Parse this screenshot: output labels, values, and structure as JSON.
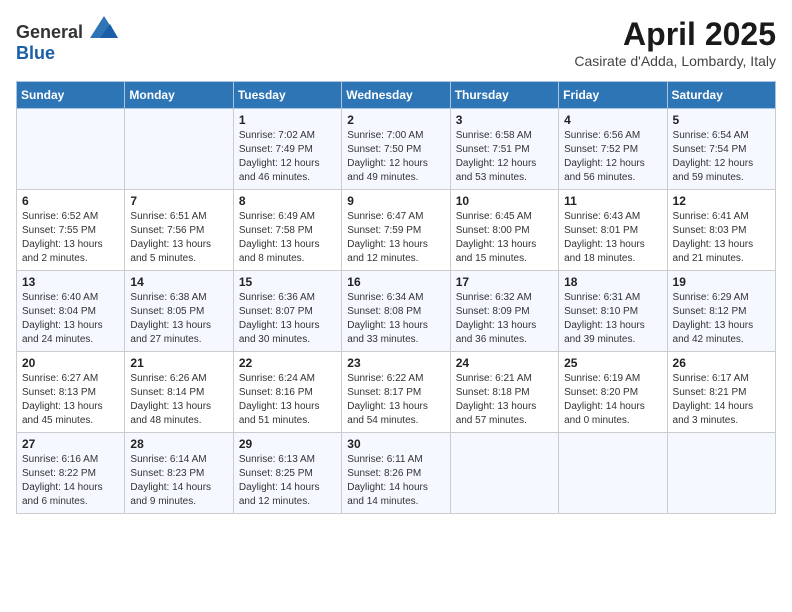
{
  "logo": {
    "general": "General",
    "blue": "Blue"
  },
  "title": "April 2025",
  "subtitle": "Casirate d'Adda, Lombardy, Italy",
  "days_of_week": [
    "Sunday",
    "Monday",
    "Tuesday",
    "Wednesday",
    "Thursday",
    "Friday",
    "Saturday"
  ],
  "weeks": [
    [
      {
        "day": null
      },
      {
        "day": null
      },
      {
        "day": "1",
        "sunrise": "Sunrise: 7:02 AM",
        "sunset": "Sunset: 7:49 PM",
        "daylight": "Daylight: 12 hours and 46 minutes."
      },
      {
        "day": "2",
        "sunrise": "Sunrise: 7:00 AM",
        "sunset": "Sunset: 7:50 PM",
        "daylight": "Daylight: 12 hours and 49 minutes."
      },
      {
        "day": "3",
        "sunrise": "Sunrise: 6:58 AM",
        "sunset": "Sunset: 7:51 PM",
        "daylight": "Daylight: 12 hours and 53 minutes."
      },
      {
        "day": "4",
        "sunrise": "Sunrise: 6:56 AM",
        "sunset": "Sunset: 7:52 PM",
        "daylight": "Daylight: 12 hours and 56 minutes."
      },
      {
        "day": "5",
        "sunrise": "Sunrise: 6:54 AM",
        "sunset": "Sunset: 7:54 PM",
        "daylight": "Daylight: 12 hours and 59 minutes."
      }
    ],
    [
      {
        "day": "6",
        "sunrise": "Sunrise: 6:52 AM",
        "sunset": "Sunset: 7:55 PM",
        "daylight": "Daylight: 13 hours and 2 minutes."
      },
      {
        "day": "7",
        "sunrise": "Sunrise: 6:51 AM",
        "sunset": "Sunset: 7:56 PM",
        "daylight": "Daylight: 13 hours and 5 minutes."
      },
      {
        "day": "8",
        "sunrise": "Sunrise: 6:49 AM",
        "sunset": "Sunset: 7:58 PM",
        "daylight": "Daylight: 13 hours and 8 minutes."
      },
      {
        "day": "9",
        "sunrise": "Sunrise: 6:47 AM",
        "sunset": "Sunset: 7:59 PM",
        "daylight": "Daylight: 13 hours and 12 minutes."
      },
      {
        "day": "10",
        "sunrise": "Sunrise: 6:45 AM",
        "sunset": "Sunset: 8:00 PM",
        "daylight": "Daylight: 13 hours and 15 minutes."
      },
      {
        "day": "11",
        "sunrise": "Sunrise: 6:43 AM",
        "sunset": "Sunset: 8:01 PM",
        "daylight": "Daylight: 13 hours and 18 minutes."
      },
      {
        "day": "12",
        "sunrise": "Sunrise: 6:41 AM",
        "sunset": "Sunset: 8:03 PM",
        "daylight": "Daylight: 13 hours and 21 minutes."
      }
    ],
    [
      {
        "day": "13",
        "sunrise": "Sunrise: 6:40 AM",
        "sunset": "Sunset: 8:04 PM",
        "daylight": "Daylight: 13 hours and 24 minutes."
      },
      {
        "day": "14",
        "sunrise": "Sunrise: 6:38 AM",
        "sunset": "Sunset: 8:05 PM",
        "daylight": "Daylight: 13 hours and 27 minutes."
      },
      {
        "day": "15",
        "sunrise": "Sunrise: 6:36 AM",
        "sunset": "Sunset: 8:07 PM",
        "daylight": "Daylight: 13 hours and 30 minutes."
      },
      {
        "day": "16",
        "sunrise": "Sunrise: 6:34 AM",
        "sunset": "Sunset: 8:08 PM",
        "daylight": "Daylight: 13 hours and 33 minutes."
      },
      {
        "day": "17",
        "sunrise": "Sunrise: 6:32 AM",
        "sunset": "Sunset: 8:09 PM",
        "daylight": "Daylight: 13 hours and 36 minutes."
      },
      {
        "day": "18",
        "sunrise": "Sunrise: 6:31 AM",
        "sunset": "Sunset: 8:10 PM",
        "daylight": "Daylight: 13 hours and 39 minutes."
      },
      {
        "day": "19",
        "sunrise": "Sunrise: 6:29 AM",
        "sunset": "Sunset: 8:12 PM",
        "daylight": "Daylight: 13 hours and 42 minutes."
      }
    ],
    [
      {
        "day": "20",
        "sunrise": "Sunrise: 6:27 AM",
        "sunset": "Sunset: 8:13 PM",
        "daylight": "Daylight: 13 hours and 45 minutes."
      },
      {
        "day": "21",
        "sunrise": "Sunrise: 6:26 AM",
        "sunset": "Sunset: 8:14 PM",
        "daylight": "Daylight: 13 hours and 48 minutes."
      },
      {
        "day": "22",
        "sunrise": "Sunrise: 6:24 AM",
        "sunset": "Sunset: 8:16 PM",
        "daylight": "Daylight: 13 hours and 51 minutes."
      },
      {
        "day": "23",
        "sunrise": "Sunrise: 6:22 AM",
        "sunset": "Sunset: 8:17 PM",
        "daylight": "Daylight: 13 hours and 54 minutes."
      },
      {
        "day": "24",
        "sunrise": "Sunrise: 6:21 AM",
        "sunset": "Sunset: 8:18 PM",
        "daylight": "Daylight: 13 hours and 57 minutes."
      },
      {
        "day": "25",
        "sunrise": "Sunrise: 6:19 AM",
        "sunset": "Sunset: 8:20 PM",
        "daylight": "Daylight: 14 hours and 0 minutes."
      },
      {
        "day": "26",
        "sunrise": "Sunrise: 6:17 AM",
        "sunset": "Sunset: 8:21 PM",
        "daylight": "Daylight: 14 hours and 3 minutes."
      }
    ],
    [
      {
        "day": "27",
        "sunrise": "Sunrise: 6:16 AM",
        "sunset": "Sunset: 8:22 PM",
        "daylight": "Daylight: 14 hours and 6 minutes."
      },
      {
        "day": "28",
        "sunrise": "Sunrise: 6:14 AM",
        "sunset": "Sunset: 8:23 PM",
        "daylight": "Daylight: 14 hours and 9 minutes."
      },
      {
        "day": "29",
        "sunrise": "Sunrise: 6:13 AM",
        "sunset": "Sunset: 8:25 PM",
        "daylight": "Daylight: 14 hours and 12 minutes."
      },
      {
        "day": "30",
        "sunrise": "Sunrise: 6:11 AM",
        "sunset": "Sunset: 8:26 PM",
        "daylight": "Daylight: 14 hours and 14 minutes."
      },
      {
        "day": null
      },
      {
        "day": null
      },
      {
        "day": null
      }
    ]
  ]
}
